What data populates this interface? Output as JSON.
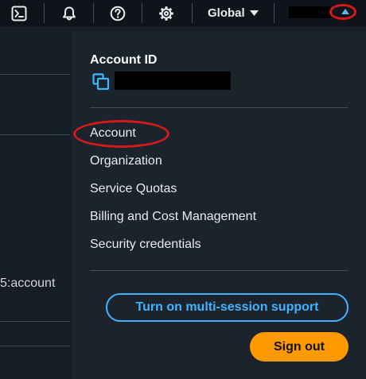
{
  "topbar": {
    "icons": {
      "cloudshell": "cloudshell-icon",
      "notifications": "bell-icon",
      "help": "help-icon",
      "settings": "gear-icon"
    },
    "region_label": "Global",
    "account_menu_caret": "caret-up-icon"
  },
  "background": {
    "fragment_text": "5:account"
  },
  "dropdown": {
    "account_id_label": "Account ID",
    "menu_items": [
      "Account",
      "Organization",
      "Service Quotas",
      "Billing and Cost Management",
      "Security credentials"
    ],
    "multi_session_button": "Turn on multi-session support",
    "sign_out_button": "Sign out"
  },
  "colors": {
    "accent_blue": "#42b4ff",
    "primary_orange": "#ff9900",
    "annotation_red": "#d31919"
  }
}
